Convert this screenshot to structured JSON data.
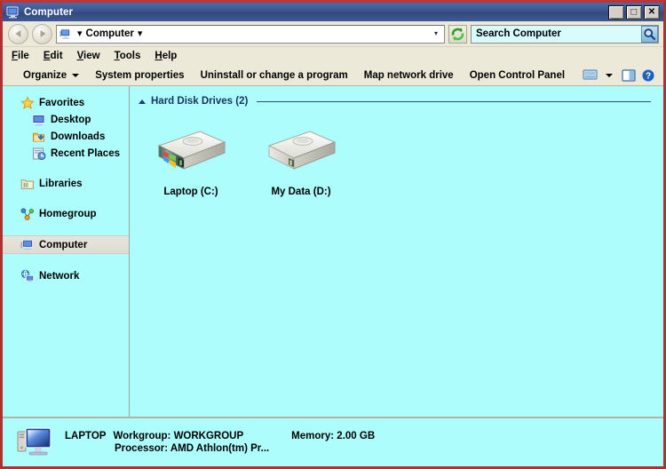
{
  "window": {
    "title": "Computer",
    "title_icon": "computer-icon",
    "controls": {
      "minimize": "_",
      "maximize": "□",
      "close": "✕"
    }
  },
  "navigation": {
    "back_label": "Back",
    "forward_label": "Forward",
    "breadcrumb": {
      "icon": "computer-icon",
      "items": [
        "Computer"
      ],
      "separator": "▾",
      "dropdown": "▾"
    },
    "refresh_label": "Refresh",
    "refresh_icon": "refresh-icon"
  },
  "search": {
    "placeholder": "Search Computer",
    "value": "",
    "icon": "search-icon"
  },
  "menubar": {
    "items": [
      {
        "key": "F",
        "rest": "ile",
        "name": "file"
      },
      {
        "key": "E",
        "rest": "dit",
        "name": "edit"
      },
      {
        "key": "V",
        "rest": "iew",
        "name": "view"
      },
      {
        "key": "T",
        "rest": "ools",
        "name": "tools"
      },
      {
        "key": "H",
        "rest": "elp",
        "name": "help"
      }
    ]
  },
  "toolbar": {
    "organize": "Organize",
    "system_properties": "System properties",
    "uninstall": "Uninstall or change a program",
    "map_drive": "Map network drive",
    "control_panel": "Open Control Panel",
    "view_icon": "view-mode-icon",
    "view_caret": "▾",
    "preview_icon": "preview-pane-icon",
    "help_icon": "help-icon"
  },
  "sidebar": {
    "groups": [
      {
        "label": "Favorites",
        "icon": "star-icon",
        "name": "favorites",
        "children": [
          {
            "label": "Desktop",
            "icon": "desktop-icon",
            "name": "desktop"
          },
          {
            "label": "Downloads",
            "icon": "downloads-icon",
            "name": "downloads"
          },
          {
            "label": "Recent Places",
            "icon": "recent-places-icon",
            "name": "recent-places"
          }
        ]
      },
      {
        "label": "Libraries",
        "icon": "libraries-icon",
        "name": "libraries",
        "children": []
      },
      {
        "label": "Homegroup",
        "icon": "homegroup-icon",
        "name": "homegroup",
        "children": []
      },
      {
        "label": "Computer",
        "icon": "computer-icon",
        "name": "computer",
        "selected": true,
        "children": []
      },
      {
        "label": "Network",
        "icon": "network-icon",
        "name": "network",
        "children": []
      }
    ]
  },
  "content": {
    "group_header": "Hard Disk Drives (2)",
    "collapse_toggle": "▴",
    "drives": [
      {
        "label": "Laptop (C:)",
        "icon": "hard-drive-system-icon",
        "system": true
      },
      {
        "label": "My Data (D:)",
        "icon": "hard-drive-icon",
        "system": false
      }
    ]
  },
  "statusbar": {
    "icon": "computer-large-icon",
    "computer_name": "LAPTOP",
    "workgroup": "Workgroup: WORKGROUP",
    "memory": "Memory: 2.00 GB",
    "processor": "Processor: AMD Athlon(tm) Pr..."
  },
  "colors": {
    "titlebar_blue": "#3a5490",
    "frame_red": "#b03030",
    "chrome_beige": "#ece9d8",
    "pane_cyan": "#aefdfd",
    "search_cyan": "#d8fbfb",
    "group_header_blue": "#16335f",
    "selection_gray": "#e4e1d6"
  }
}
